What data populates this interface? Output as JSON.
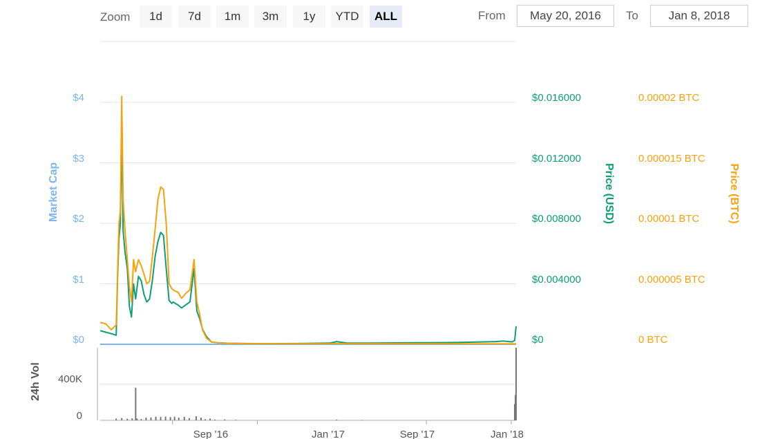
{
  "toolbar": {
    "zoom_label": "Zoom",
    "buttons": [
      "1d",
      "7d",
      "1m",
      "3m",
      "1y",
      "YTD",
      "ALL"
    ],
    "active": "ALL",
    "from_label": "From",
    "from_value": "May 20, 2016",
    "to_label": "To",
    "to_value": "Jan 8, 2018"
  },
  "colors": {
    "market_cap": "#7cb5ec",
    "price_usd": "#0e9e74",
    "price_btc": "#f7a20c",
    "volume": "#777777",
    "grid": "#e6e6e6",
    "axis_line": "#aaaaaa",
    "zoom_active_bg": "#e6ebf5",
    "zoom_bg": "#f7f7f7"
  },
  "chart_data": {
    "type": "line",
    "x_range": [
      "2016-05-20",
      "2018-01-08"
    ],
    "x_ticks": [
      "Sep '16",
      "Jan '17",
      "Sep '17",
      "Jan '18"
    ],
    "axes": {
      "market_cap": {
        "title": "Market Cap",
        "ticks": [
          "$0",
          "$1",
          "$2",
          "$3",
          "$4"
        ],
        "range": [
          0,
          4
        ]
      },
      "price_usd": {
        "title": "Price (USD)",
        "ticks": [
          "$0",
          "$0.004000",
          "$0.008000",
          "$0.012000",
          "$0.016000"
        ],
        "range": [
          0,
          0.016
        ]
      },
      "price_btc": {
        "title": "Price (BTC)",
        "ticks": [
          "0 BTC",
          "0.000005 BTC",
          "0.00001 BTC",
          "0.000015 BTC",
          "0.00002 BTC"
        ],
        "range": [
          0,
          2e-05
        ]
      },
      "volume": {
        "title": "24h Vol",
        "ticks": [
          "0",
          "400K"
        ],
        "range": [
          0,
          800000
        ]
      }
    },
    "series": [
      {
        "name": "Price (USD)",
        "x": [
          "2016-05-20",
          "2016-05-28",
          "2016-06-05",
          "2016-06-12",
          "2016-06-14",
          "2016-06-16",
          "2016-06-18",
          "2016-06-20",
          "2016-06-22",
          "2016-06-25",
          "2016-06-28",
          "2016-07-01",
          "2016-07-04",
          "2016-07-07",
          "2016-07-10",
          "2016-07-14",
          "2016-07-18",
          "2016-07-22",
          "2016-07-26",
          "2016-07-30",
          "2016-08-03",
          "2016-08-07",
          "2016-08-11",
          "2016-08-15",
          "2016-08-19",
          "2016-08-23",
          "2016-08-27",
          "2016-08-31",
          "2016-09-02",
          "2016-09-05",
          "2016-09-09",
          "2016-09-14",
          "2016-09-20",
          "2016-09-26",
          "2016-10-02",
          "2016-10-06",
          "2016-10-10",
          "2016-10-14",
          "2016-10-20",
          "2016-10-27",
          "2016-11-05",
          "2016-11-20",
          "2016-12-15",
          "2017-01-15",
          "2017-03-01",
          "2017-04-15",
          "2017-04-25",
          "2017-05-10",
          "2017-06-15",
          "2017-08-15",
          "2017-10-15",
          "2017-12-10",
          "2017-12-20",
          "2018-01-02",
          "2018-01-06",
          "2018-01-08"
        ],
        "values": [
          0.0009,
          0.0008,
          0.0007,
          0.0006,
          0.0044,
          0.007,
          0.008,
          0.014,
          0.0075,
          0.006,
          0.005,
          0.0025,
          0.0018,
          0.004,
          0.003,
          0.0045,
          0.0042,
          0.0033,
          0.0028,
          0.003,
          0.0042,
          0.0058,
          0.0068,
          0.0074,
          0.0072,
          0.005,
          0.0029,
          0.0027,
          0.0028,
          0.0027,
          0.0026,
          0.0024,
          0.0026,
          0.0028,
          0.005,
          0.0022,
          0.0017,
          0.001,
          0.0005,
          0.00015,
          0.0001,
          7e-05,
          5e-05,
          4e-05,
          5e-05,
          8e-05,
          0.00018,
          8e-05,
          8e-05,
          0.0001,
          0.00012,
          0.00018,
          0.00022,
          0.00016,
          0.00025,
          0.0012
        ]
      },
      {
        "name": "Price (BTC)",
        "x": [
          "2016-05-20",
          "2016-05-28",
          "2016-06-05",
          "2016-06-12",
          "2016-06-14",
          "2016-06-16",
          "2016-06-18",
          "2016-06-20",
          "2016-06-22",
          "2016-06-25",
          "2016-06-28",
          "2016-07-01",
          "2016-07-04",
          "2016-07-07",
          "2016-07-10",
          "2016-07-14",
          "2016-07-18",
          "2016-07-22",
          "2016-07-26",
          "2016-07-30",
          "2016-08-03",
          "2016-08-07",
          "2016-08-11",
          "2016-08-15",
          "2016-08-19",
          "2016-08-23",
          "2016-08-27",
          "2016-08-31",
          "2016-09-02",
          "2016-09-05",
          "2016-09-09",
          "2016-09-14",
          "2016-09-20",
          "2016-09-26",
          "2016-10-02",
          "2016-10-06",
          "2016-10-10",
          "2016-10-14",
          "2016-10-20",
          "2016-10-27",
          "2016-11-05",
          "2016-11-20",
          "2016-12-15",
          "2017-01-15",
          "2017-03-01",
          "2017-04-15",
          "2017-04-25",
          "2017-05-10",
          "2017-06-15",
          "2017-08-15",
          "2017-10-15",
          "2017-12-10",
          "2017-12-20",
          "2018-01-02",
          "2018-01-06",
          "2018-01-08"
        ],
        "values": [
          1.8e-06,
          1.7e-06,
          1.2e-06,
          1.6e-06,
          6e-06,
          1e-05,
          1.1e-05,
          2.05e-05,
          1.2e-05,
          9.2e-06,
          7e-06,
          4.8e-06,
          3.5e-06,
          7e-06,
          6e-06,
          7e-06,
          6.5e-06,
          5.8e-06,
          5e-06,
          5.2e-06,
          7.2e-06,
          9.5e-06,
          1.2e-05,
          1.3e-05,
          1.28e-05,
          1e-05,
          5e-06,
          4.6e-06,
          4.5e-06,
          4.4e-06,
          4.3e-06,
          3.8e-06,
          4.2e-06,
          4.5e-06,
          7e-06,
          3.5e-06,
          2.5e-06,
          1.2e-06,
          5e-07,
          2e-07,
          1.2e-07,
          8e-08,
          5e-08,
          4e-08,
          4e-08,
          4e-08,
          6e-08,
          4e-08,
          4e-08,
          4e-08,
          4e-08,
          4e-08,
          4e-08,
          4e-08,
          4e-08,
          4e-08
        ]
      },
      {
        "name": "Market Cap",
        "x": [
          "2016-05-20",
          "2018-01-08"
        ],
        "values": [
          0,
          0
        ]
      },
      {
        "name": "24h Vol",
        "x": [
          "2016-06-12",
          "2016-06-20",
          "2016-06-28",
          "2016-07-05",
          "2016-07-10",
          "2016-07-12",
          "2016-07-18",
          "2016-07-25",
          "2016-08-01",
          "2016-08-08",
          "2016-08-15",
          "2016-08-22",
          "2016-08-29",
          "2016-09-04",
          "2016-09-10",
          "2016-09-18",
          "2016-09-25",
          "2016-10-05",
          "2016-10-12",
          "2016-10-18",
          "2016-10-25",
          "2016-11-01",
          "2016-11-15",
          "2016-12-01",
          "2017-04-25",
          "2017-06-01",
          "2018-01-06",
          "2018-01-07",
          "2018-01-08"
        ],
        "values": [
          20000,
          25000,
          18000,
          22000,
          360000,
          20000,
          15000,
          30000,
          32000,
          40000,
          38000,
          42000,
          35000,
          40000,
          30000,
          38000,
          25000,
          45000,
          30000,
          12000,
          20000,
          8000,
          10000,
          6000,
          8000,
          5000,
          180000,
          280000,
          800000
        ]
      }
    ]
  }
}
